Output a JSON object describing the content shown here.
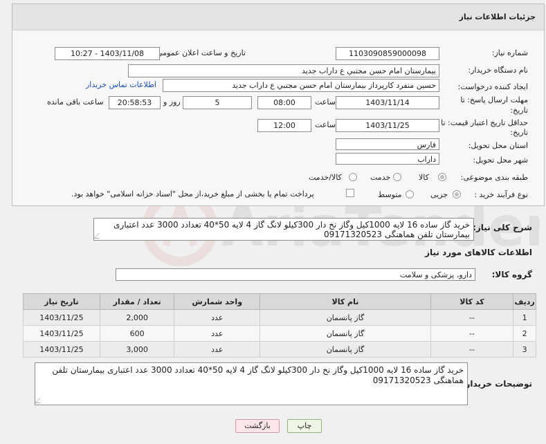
{
  "header": {
    "title": "جزئیات اطلاعات نیاز"
  },
  "fields": {
    "need_number_label": "شماره نیاز:",
    "need_number": "1103090859000098",
    "announce_label": "تاریخ و ساعت اعلان عمومی:",
    "announce_value": "1403/11/08 - 10:27",
    "buyer_org_label": "نام دستگاه خریدار:",
    "buyer_org": "بیمارستان امام حسن مجتبي  ع  داراب جديد",
    "requester_label": "ایجاد کننده درخواست:",
    "requester": "حسین  منفرد کارپرداز بیمارستان امام حسن مجتبي  ع  داراب جديد",
    "contact_link": "اطلاعات تماس خریدار",
    "deadline_label": "مهلت ارسال پاسخ: تا",
    "deadline_label2": "تاریخ:",
    "deadline_date": "1403/11/14",
    "time_label": "ساعت",
    "deadline_time": "08:00",
    "days_value": "5",
    "days_label": "روز و",
    "remaining_time": "20:58:53",
    "remaining_label": "ساعت باقی مانده",
    "validity_label": "حداقل تاریخ اعتبار قیمت: تا",
    "validity_label2": "تاریخ:",
    "validity_date": "1403/11/25",
    "validity_time_label": "ساعت",
    "validity_time": "12:00",
    "province_label": "استان محل تحویل:",
    "province": "فارس",
    "city_label": "شهر محل تحویل:",
    "city": "داراب",
    "category_label": "طبقه بندی موضوعی:",
    "category_options": [
      "کالا",
      "خدمت",
      "کالا/خدمت"
    ],
    "process_label": "نوع فرآیند خرید :",
    "process_options": [
      "جزیی",
      "متوسط"
    ],
    "payment_note": "پرداخت تمام یا بخشی از مبلغ خرید،از محل \"اسناد خزانه اسلامی\" خواهد بود."
  },
  "general_desc": {
    "label": "شرح کلی نیاز:",
    "text": "خرید گاز ساده 16 لایه 1000کیل وگاز نخ دار 300کیلو  لانگ گاز 4 لایه 50*40 تعدادد 3000 عدد اعتباری بیمارستان تلفن هماهنگی 09171320523"
  },
  "goods_section": {
    "title": "اطلاعات کالاهای مورد نیاز",
    "group_label": "گروه کالا:",
    "group_value": "دارو، پزشکی و سلامت"
  },
  "table": {
    "headers": [
      "ردیف",
      "کد کالا",
      "نام کالا",
      "واحد شمارش",
      "تعداد / مقدار",
      "تاریخ نیاز"
    ],
    "rows": [
      [
        "1",
        "--",
        "گاز پانسمان",
        "عدد",
        "2,000",
        "1403/11/25"
      ],
      [
        "2",
        "--",
        "گاز پانسمان",
        "عدد",
        "600",
        "1403/11/25"
      ],
      [
        "3",
        "--",
        "گاز پانسمان",
        "عدد",
        "3,000",
        "1403/11/25"
      ]
    ]
  },
  "buyer_notes": {
    "label": "توضیحات خریدار:",
    "text": "خرید گاز ساده 16 لایه 1000کیل وگاز نخ دار 300کیلو  لانگ گاز 4 لایه 50*40 تعدادد 3000 عدد اعتباری بیمارستان تلفن هماهنگی 09171320523"
  },
  "buttons": {
    "print": "چاپ",
    "back": "بازگشت"
  },
  "colors": {
    "link": "#1a4fb5",
    "print_bg": "#eef7e6",
    "back_bg": "#fbe6ea",
    "header_bg": "#e4e4e4"
  }
}
